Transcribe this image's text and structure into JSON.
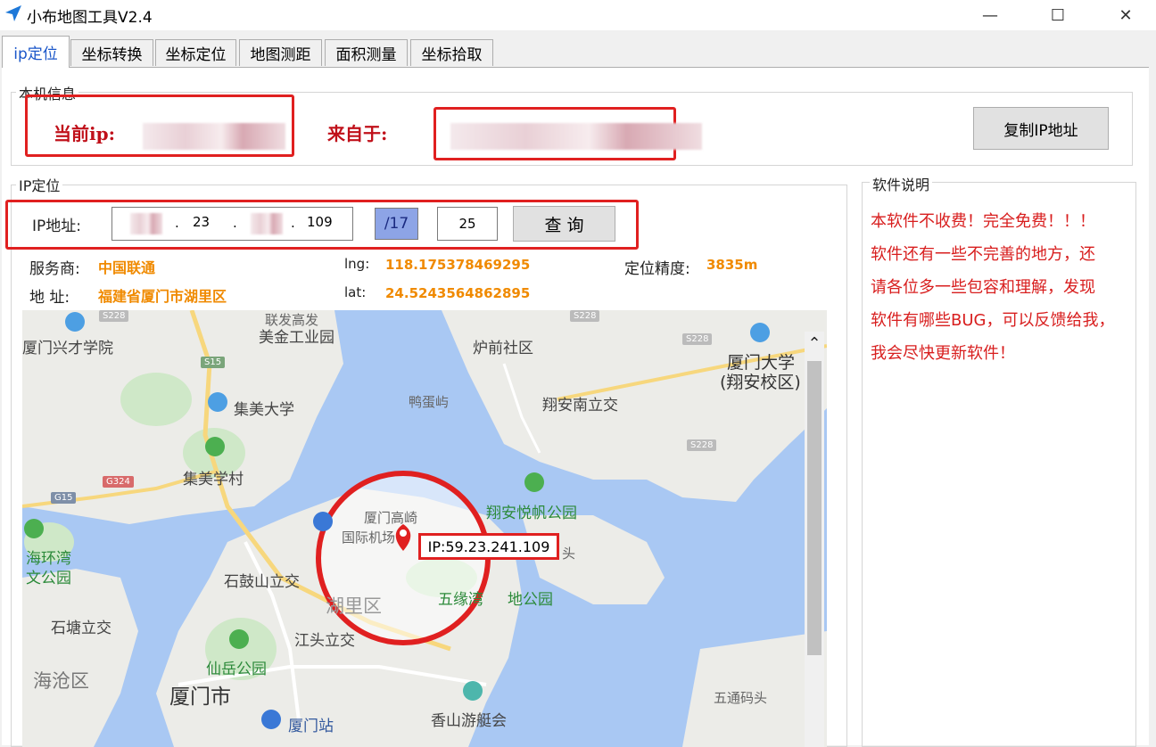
{
  "window": {
    "title": "小布地图工具V2.4",
    "minimize": "—",
    "maximize": "☐",
    "close": "✕"
  },
  "tabs": [
    "ip定位",
    "坐标转换",
    "坐标定位",
    "地图测距",
    "面积测量",
    "坐标拾取"
  ],
  "local_info": {
    "group_title": "本机信息",
    "current_ip_label": "当前ip:",
    "from_label": "来自于:",
    "copy_button": "复制IP地址"
  },
  "ip_locate": {
    "group_title": "IP定位",
    "ip_label": "IP地址:",
    "octet2": "23",
    "octet4": "109",
    "prefix": "/17",
    "zoom": "25",
    "query_button": "查 询",
    "dot": "."
  },
  "result": {
    "isp_label": "服务商:",
    "isp_value": "中国联通",
    "address_label": "地 址:",
    "address_value": "福建省厦门市湖里区",
    "lng_label": "lng:",
    "lng_value": "118.175378469295",
    "lat_label": "lat:",
    "lat_value": "24.5243564862895",
    "accuracy_label": "定位精度:",
    "accuracy_value": "3835m"
  },
  "software_note": {
    "group_title": "软件说明",
    "lines": [
      "本软件不收费！完全免费！！！",
      "软件还有一些不完善的地方，还",
      "请各位多一些包容和理解，发现",
      "软件有哪些BUG，可以反馈给我，",
      "我会尽快更新软件！"
    ]
  },
  "map": {
    "marker_label": "IP:59.23.241.109",
    "labels": {
      "l1": "厦门兴才学院",
      "l2": "美金工业园",
      "l3": "炉前社区",
      "l4": "厦门大学",
      "l5": "(翔安校区)",
      "l6": "集美大学",
      "l7": "鸭蛋屿",
      "l8": "翔安南立交",
      "l9": "集美学村",
      "l10": "翔安悦帆公园",
      "l11": "厦门高崎",
      "l12": "国际机场",
      "l13": "海环湾",
      "l14": "文公园",
      "l15": "石鼓山立交",
      "l16": "湖里区",
      "l17": "五缘湾",
      "l18": "地公园",
      "l19": "石塘立交",
      "l20": "江头立交",
      "l21": "仙岳公园",
      "l22": "海沧区",
      "l23": "厦门市",
      "l24": "厦门站",
      "l25": "香山游艇会",
      "l26": "五通码头",
      "l27": "联发高发",
      "l28": "头"
    },
    "shields": {
      "s1": "G15",
      "s2": "G324",
      "s3": "S15",
      "s4": "S228",
      "s5": "S228",
      "s6": "S228",
      "s7": "S228"
    }
  },
  "colors": {
    "highlight_red": "#e02020",
    "label_red": "#c0101a",
    "value_orange": "#f08a00",
    "note_red": "#d81e1e",
    "sea": "#a9c8f3",
    "land": "#ecece8"
  }
}
